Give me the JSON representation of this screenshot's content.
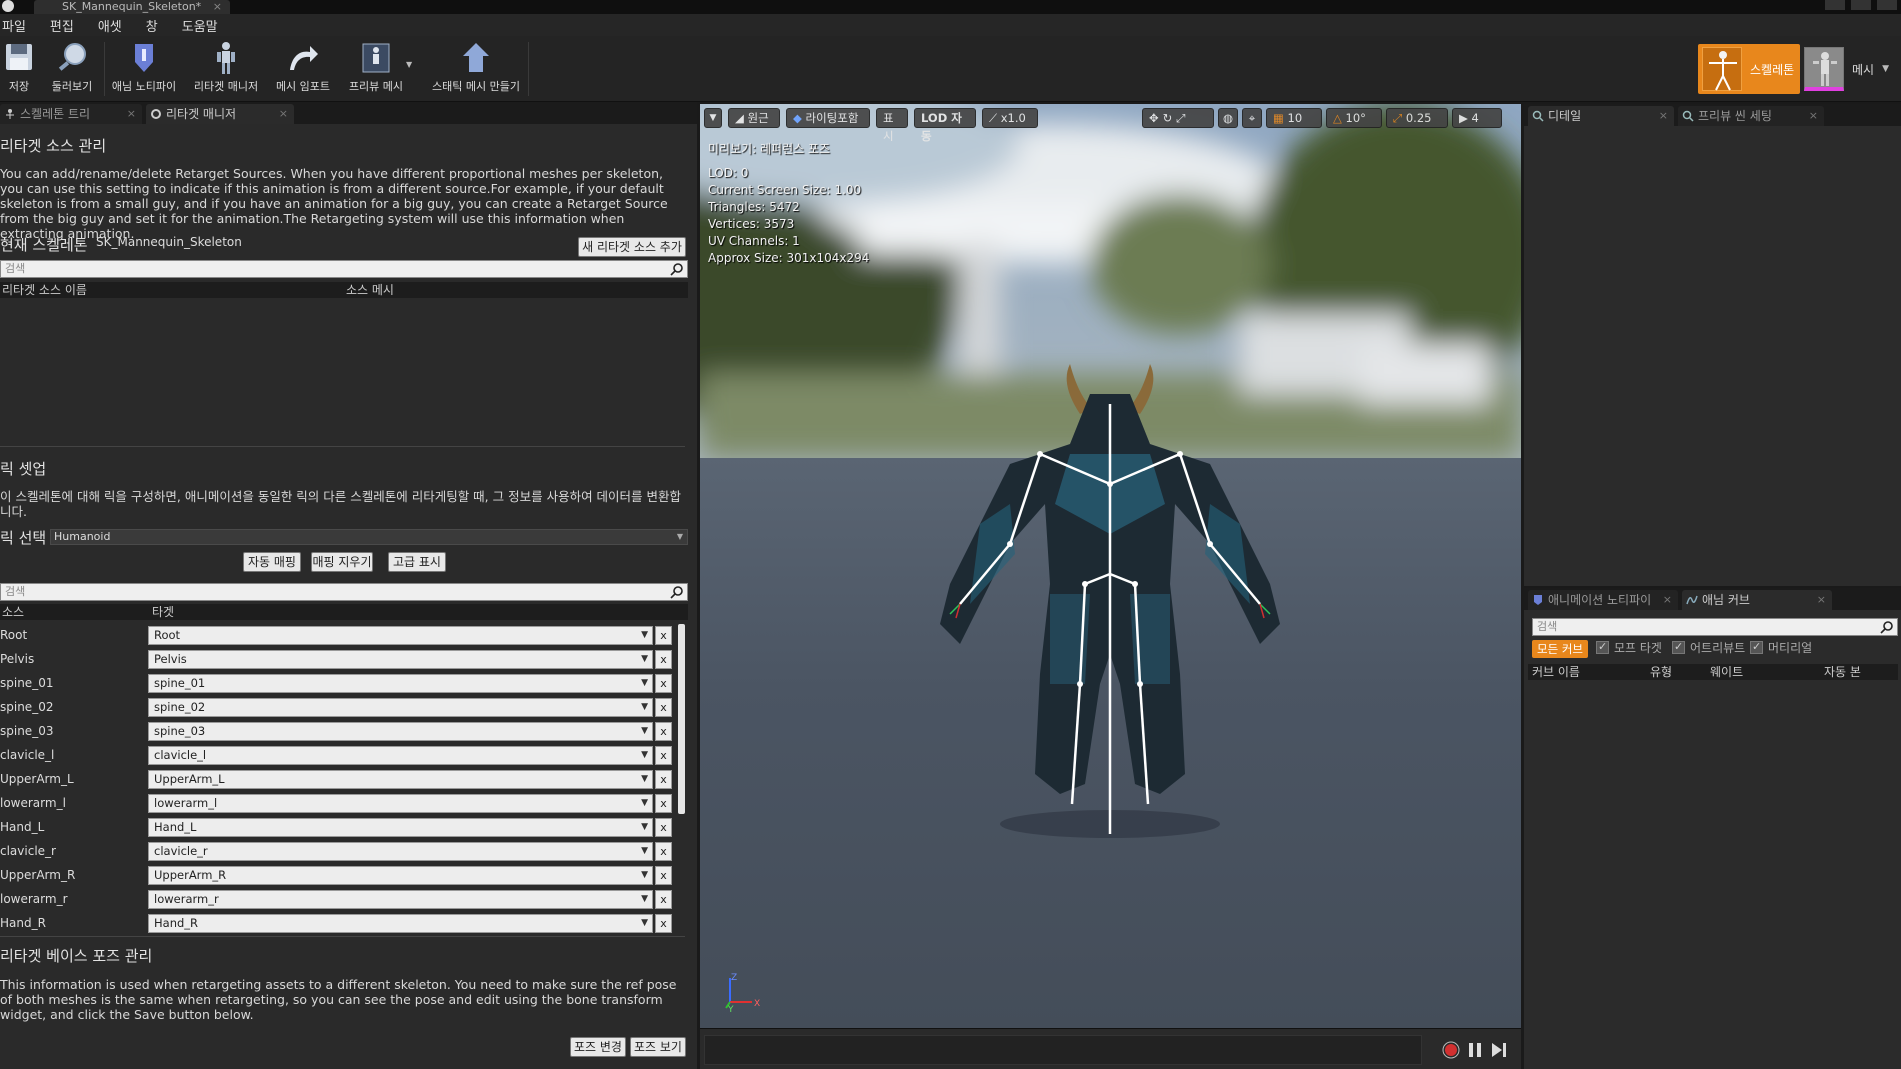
{
  "window": {
    "doc_tab": "SK_Mannequin_Skeleton*"
  },
  "menu": [
    "파일",
    "편집",
    "애셋",
    "창",
    "도움말"
  ],
  "toolbar": {
    "buttons": [
      {
        "label": "저장",
        "icon": "save-icon"
      },
      {
        "label": "둘러보기",
        "icon": "browse-icon"
      },
      {
        "label": "애님 노티파이",
        "icon": "anim-notify-icon"
      },
      {
        "label": "리타겟 매니저",
        "icon": "retarget-manager-icon"
      },
      {
        "label": "메시 임포트",
        "icon": "mesh-import-icon"
      },
      {
        "label": "프리뷰 메시",
        "icon": "preview-mesh-icon"
      },
      {
        "label": "스태틱 메시 만들기",
        "icon": "make-static-mesh-icon"
      }
    ],
    "mode_skeleton": "스켈레톤",
    "mode_mesh": "메시"
  },
  "left_tabs": [
    {
      "label": "스켈레톤 트리",
      "active": false
    },
    {
      "label": "리타겟 매니저",
      "active": true
    }
  ],
  "retarget_source": {
    "title": "리타겟 소스 관리",
    "description": "You can add/rename/delete Retarget Sources. When you have different proportional meshes per skeleton, you can use this setting to indicate if this animation is from a different source.For example, if your default skeleton is from a small guy, and if you have an animation for a big guy, you can create a Retarget Source from the big guy and set it for the animation.The Retargeting system will use this information when extracting animation.",
    "current_skeleton_label": "현재 스켈레톤",
    "current_skeleton_value": "SK_Mannequin_Skeleton",
    "add_button": "새 리타겟 소스 추가",
    "search_placeholder": "검색",
    "col_name": "리타겟 소스 이름",
    "col_mesh": "소스 메시"
  },
  "rig_setup": {
    "title": "릭 셋업",
    "description": "이 스켈레톤에 대해 릭을 구성하면, 애니메이션을 동일한 릭의 다른 스켈레톤에 리타게팅할 때, 그 정보를 사용하여 데이터를 변환합니다.",
    "rig_select_label": "릭 선택",
    "rig_select_value": "Humanoid",
    "auto_map": "자동 매핑",
    "clear_map": "매핑 지우기",
    "advanced": "고급 표시",
    "search_placeholder": "검색",
    "col_source": "소스",
    "col_target": "타겟",
    "rows": [
      {
        "source": "Root",
        "target": "Root"
      },
      {
        "source": "Pelvis",
        "target": "Pelvis"
      },
      {
        "source": "spine_01",
        "target": "spine_01"
      },
      {
        "source": "spine_02",
        "target": "spine_02"
      },
      {
        "source": "spine_03",
        "target": "spine_03"
      },
      {
        "source": "clavicle_l",
        "target": "clavicle_l"
      },
      {
        "source": "UpperArm_L",
        "target": "UpperArm_L"
      },
      {
        "source": "lowerarm_l",
        "target": "lowerarm_l"
      },
      {
        "source": "Hand_L",
        "target": "Hand_L"
      },
      {
        "source": "clavicle_r",
        "target": "clavicle_r"
      },
      {
        "source": "UpperArm_R",
        "target": "UpperArm_R"
      },
      {
        "source": "lowerarm_r",
        "target": "lowerarm_r"
      },
      {
        "source": "Hand_R",
        "target": "Hand_R"
      }
    ],
    "x_label": "x"
  },
  "base_pose": {
    "title": "리타겟 베이스 포즈 관리",
    "description": "This information is used when retargeting assets to a different skeleton. You need to make sure the ref pose of both meshes is the same when retargeting, so you can see the pose and edit using the bone transform widget, and click the Save button below.",
    "modify_button": "포즈 변경",
    "view_button": "포즈 보기"
  },
  "viewport": {
    "perspective": "원근",
    "lighting": "라이팅포함",
    "show": "표시",
    "lod": "LOD 자동",
    "speed": "x1.0",
    "grid_snap": "10",
    "rot_snap": "10°",
    "scale_snap": "0.25",
    "cam_speed": "4",
    "preview_label": "미리보기: 레퍼런스 포즈",
    "stats": [
      "LOD: 0",
      "Current Screen Size: 1.00",
      "Triangles: 5472",
      "Vertices: 3573",
      "UV Channels: 1",
      "Approx Size: 301x104x294"
    ],
    "axis_z": "Z",
    "axis_x": "X",
    "axis_y": "Y"
  },
  "right_top_tabs": [
    {
      "label": "디테일",
      "active": true
    },
    {
      "label": "프리뷰 씬 세팅",
      "active": false
    }
  ],
  "right_bottom_tabs": [
    {
      "label": "애니메이션 노티파이",
      "active": false
    },
    {
      "label": "애님 커브",
      "active": true
    }
  ],
  "anim_curves": {
    "search_placeholder": "검색",
    "filter_all": "모든 커브",
    "filter_morph": "모프 타겟",
    "filter_attr": "어트리뷰트",
    "filter_material": "머티리얼",
    "col_name": "커브 이름",
    "col_type": "유형",
    "col_weight": "웨이트",
    "col_auto": "자동 본"
  },
  "colors": {
    "accent": "#e8871c",
    "panel": "#2b2b2b",
    "record": "#d23030"
  }
}
